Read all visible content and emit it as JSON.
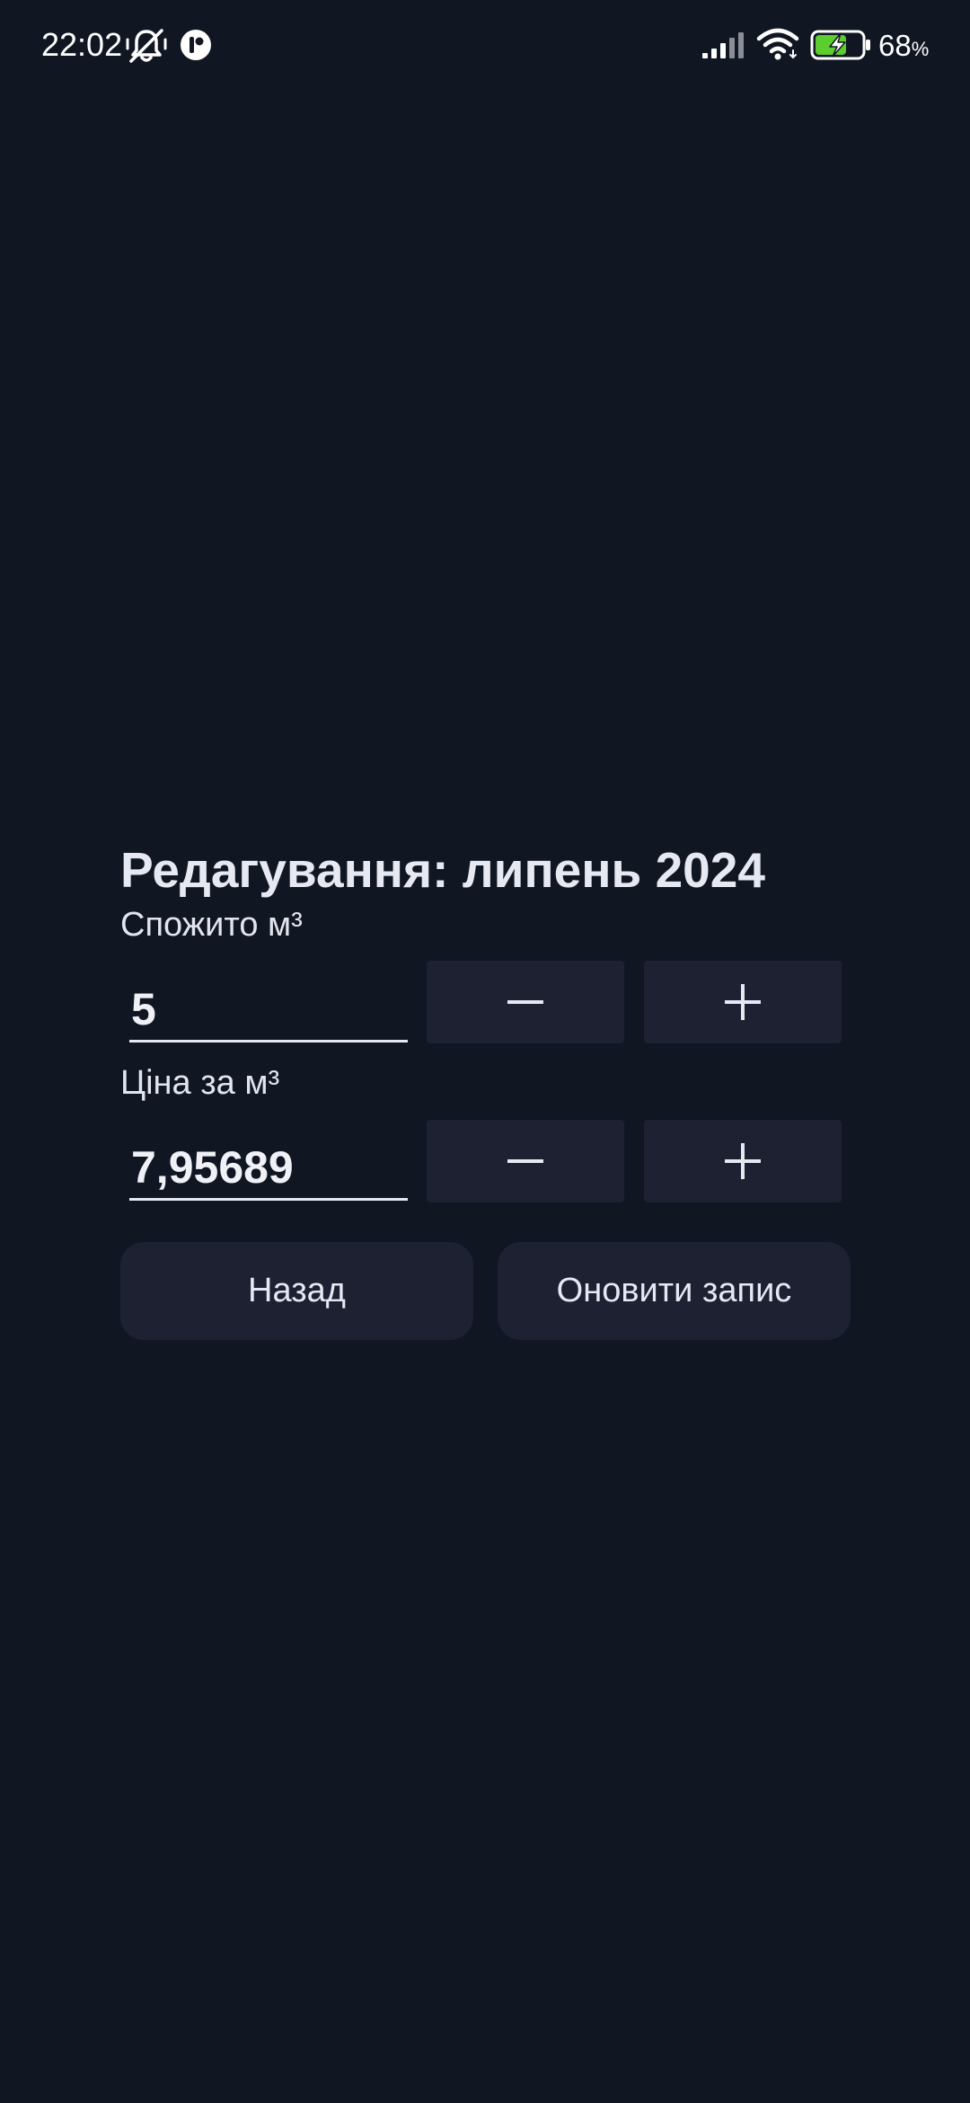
{
  "status_bar": {
    "time": "22:02",
    "battery_number": "68",
    "battery_unit": "%",
    "icons": [
      "bell-muted-icon",
      "app-notification-icon",
      "cellular-signal-icon",
      "wifi-icon",
      "battery-charging-icon"
    ]
  },
  "form": {
    "title": "Редагування: липень 2024",
    "consumed": {
      "label": "Спожито м³",
      "value": "5"
    },
    "price": {
      "label": "Ціна за м³",
      "value": "7,95689"
    },
    "stepper_icons": {
      "minus": "minus-icon",
      "plus": "plus-icon"
    },
    "buttons": {
      "back": "Назад",
      "update": "Оновити запис"
    }
  },
  "colors": {
    "background": "#111623",
    "surface": "#1d2132",
    "text": "#e6e8f2",
    "battery_fill": "#5ccd2f"
  }
}
